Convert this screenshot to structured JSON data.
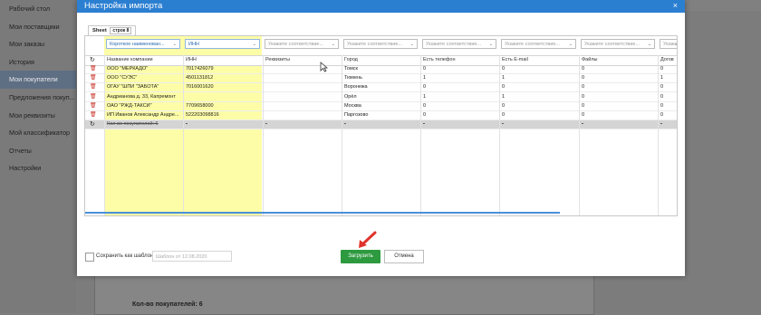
{
  "background": {
    "sidebar": [
      "Рабочий стол",
      "Мои поставщики",
      "Мои заказы",
      "История",
      "Мои покупатели",
      "Предложения покуп...",
      "Мои реквизиты",
      "Мой классификатор",
      "Отчеты",
      "Настройки"
    ],
    "sidebar_active_index": 4,
    "buyers_count": "Кол-во покупателей: 6"
  },
  "modal": {
    "title": "Настройка импорта",
    "close": "×",
    "tab": {
      "label": "Sheet",
      "badge": "строк 8"
    },
    "selectors": [
      "Короткое наименован...",
      "ИНН",
      "Укажите соответствие...",
      "Укажите соответствие...",
      "Укажите соответствие...",
      "Укажите соответствие...",
      "Укажите соответствие...",
      "Укажите соответствие..."
    ],
    "columns": [
      "Название компании",
      "ИНН",
      "Реквизиты",
      "Город",
      "Есть телефон",
      "Есть E-mail",
      "Файлы",
      "Догов"
    ],
    "rows": [
      {
        "name": "ООО \"МЕРКАДО\"",
        "inn": "7017426079",
        "req": "",
        "city": "Томск",
        "phone": "0",
        "email": "0",
        "files": "0",
        "dog": "0"
      },
      {
        "name": "ООО \"СУЭС\"",
        "inn": "4501131812",
        "req": "",
        "city": "Тюмень",
        "phone": "1",
        "email": "1",
        "files": "0",
        "dog": "1"
      },
      {
        "name": "ОГАУ \"ШПИ \"ЗАБОТА\"",
        "inn": "7016001620",
        "req": "",
        "city": "Воронежа",
        "phone": "0",
        "email": "0",
        "files": "0",
        "dog": "0"
      },
      {
        "name": "Андрианова д. 33, Капремонт",
        "inn": "",
        "req": "",
        "city": "Орёл",
        "phone": "1",
        "email": "1",
        "files": "0",
        "dog": "0"
      },
      {
        "name": "ОАО \"РЖД-ТАКСИ\"",
        "inn": "7709658000",
        "req": "",
        "city": "Москва",
        "phone": "0",
        "email": "0",
        "files": "0",
        "dog": "0"
      },
      {
        "name": "ИП Иванов Александр Андре...",
        "inn": "522203098816",
        "req": "",
        "city": "Паргозово",
        "phone": "0",
        "email": "0",
        "files": "0",
        "dog": "0"
      },
      {
        "name": "Кол-во покупателей: 6",
        "inn": "-",
        "req": "-",
        "city": "-",
        "phone": "-",
        "email": "-",
        "files": "-",
        "dog": "-"
      }
    ],
    "save_template_label": "Сохранить как шаблон",
    "template_placeholder": "Шаблон от 12.08.2020",
    "load_button": "Загрузить",
    "cancel_button": "Отмена",
    "colors": {
      "header": "#2b7fd1",
      "load": "#2e9a3f",
      "highlight": "#fdfda8",
      "delete": "#c8352a"
    }
  }
}
